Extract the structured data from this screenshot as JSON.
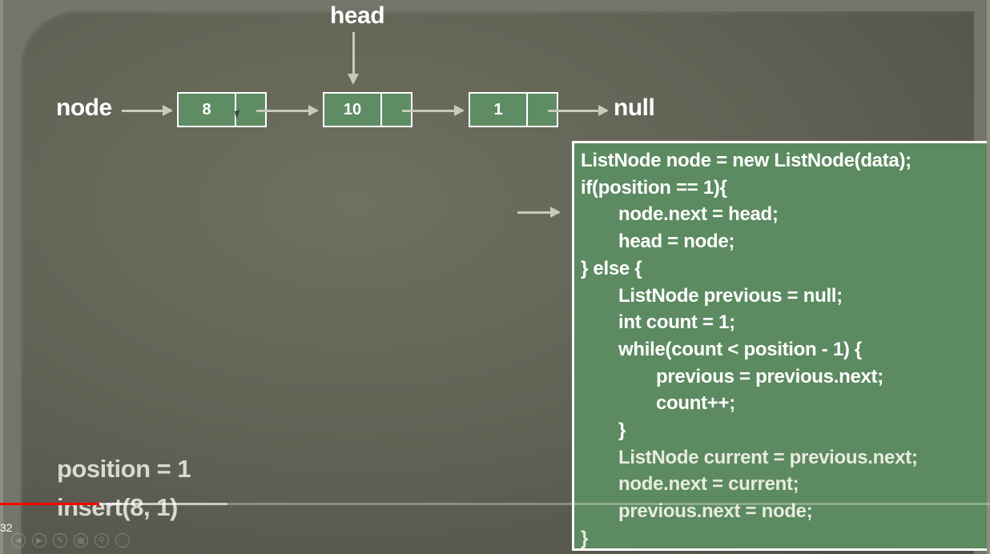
{
  "diagram": {
    "head_label": "head",
    "node_label": "node",
    "null_label": "null",
    "nodes": [
      "8",
      "10",
      "1"
    ]
  },
  "code": {
    "lines": [
      "ListNode node = new ListNode(data);",
      "if(position == 1){",
      "node.next = head;",
      "head = node;",
      "} else {",
      "ListNode previous = null;",
      "int count = 1;",
      "while(count < position - 1) {",
      "previous = previous.next;",
      "count++;",
      "}",
      "ListNode current = previous.next;",
      "node.next = current;",
      "previous.next = node;",
      "}"
    ]
  },
  "bottom": {
    "position_text": "position = 1",
    "insert_text": "insert(8, 1)"
  },
  "player": {
    "timecode": "32",
    "progress_percent": 10,
    "buffered_percent": 23,
    "colors": {
      "progress": "#ff0000"
    }
  },
  "colors": {
    "node_fill": "#5e8d64",
    "code_fill": "#5c8a61",
    "arrow": "#c8c8bb"
  }
}
